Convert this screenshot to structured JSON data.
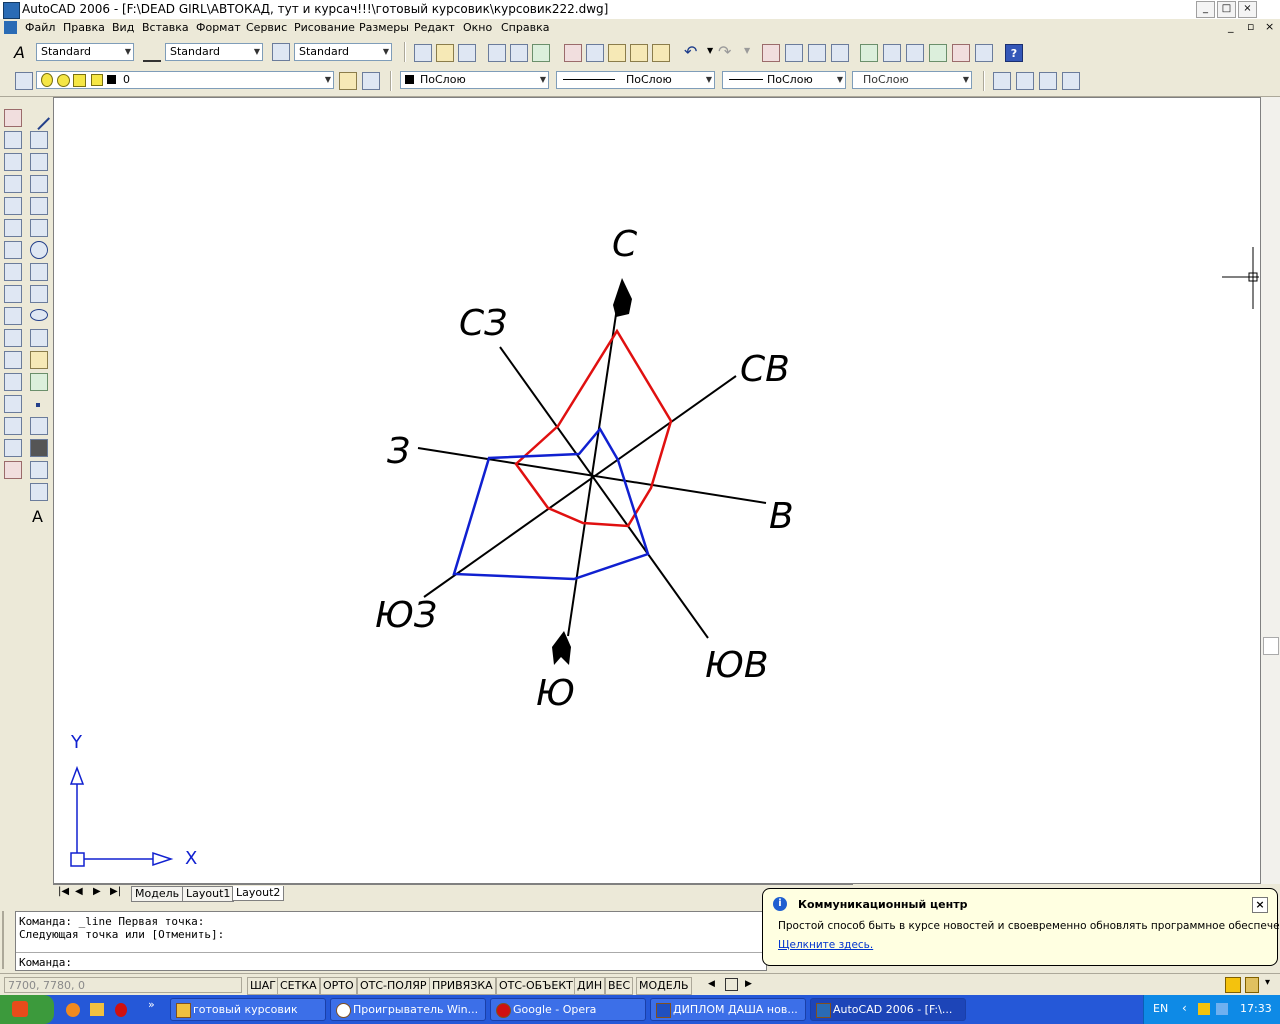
{
  "window": {
    "title": "AutoCAD 2006 - [F:\\DEAD GIRL\\АВТОКАД, тут и курсач!!!\\готовый курсовик\\курсовик222.dwg]",
    "controls": [
      "_",
      "□",
      "×"
    ],
    "doc_controls": [
      "_",
      "▫",
      "×"
    ]
  },
  "menu": [
    "Файл",
    "Правка",
    "Вид",
    "Вставка",
    "Формат",
    "Сервис",
    "Рисование",
    "Размеры",
    "Редакт",
    "Окно",
    "Справка"
  ],
  "styles_toolbar": {
    "text_style": "Standard",
    "dim_style": "Standard",
    "table_style": "Standard"
  },
  "layers_toolbar": {
    "layer": "0",
    "color": "ПоСлою",
    "linetype": "ПоСлою",
    "lineweight": "ПоСлою",
    "plotstyle": "ПоСлою"
  },
  "drawing": {
    "labels": {
      "n": "С",
      "ne": "СВ",
      "e": "В",
      "se": "ЮВ",
      "s": "Ю",
      "sw": "ЮЗ",
      "w": "З",
      "nw": "СЗ"
    },
    "ucs_x": "X",
    "ucs_y": "Y",
    "colors": {
      "red": "#e01010",
      "blue": "#1020d0",
      "axes": "#000000"
    }
  },
  "tabs": [
    "Модель",
    "Layout1",
    "Layout2"
  ],
  "active_tab": "Layout2",
  "command": {
    "line1": "Команда: _line Первая точка:",
    "line2": "Следующая точка или [Отменить]:",
    "prompt": "Команда:"
  },
  "status": {
    "coords": "7700, 7780, 0",
    "buttons": [
      "ШАГ",
      "СЕТКА",
      "ОРТО",
      "ОТС-ПОЛЯР",
      "ПРИВЯЗКА",
      "ОТС-ОБЪЕКТ",
      "ДИН",
      "ВЕС",
      "МОДЕЛЬ"
    ]
  },
  "balloon": {
    "title": "Коммуникационный центр",
    "body": "Простой способ быть в курсе новостей и своевременно обновлять программное обеспечение.",
    "link": "Щелкните здесь."
  },
  "taskbar": {
    "tasks": [
      "готовый курсовик",
      "Проигрыватель Win...",
      "Google - Opera",
      "ДИПЛОМ ДАША нов...",
      "AutoCAD 2006 - [F:\\..."
    ],
    "lang": "EN",
    "time": "17:33"
  }
}
